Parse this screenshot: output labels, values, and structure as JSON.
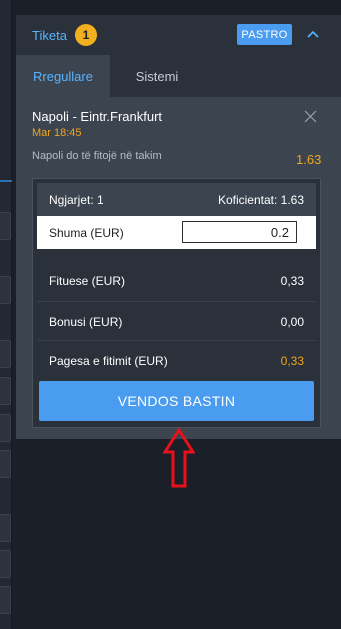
{
  "ticket": {
    "title": "Tiketa",
    "count": "1",
    "clear_label": "PASTRO",
    "collapse_icon": "chevron-up-icon"
  },
  "tabs": [
    {
      "label": "Rregullare",
      "active": true
    },
    {
      "label": "Sistemi",
      "active": false
    }
  ],
  "selection": {
    "match": "Napoli - Eintr.Frankfurt",
    "time": "Mar 18:45",
    "market": "Napoli do të fitojë në takim",
    "odd": "1.63"
  },
  "summary": {
    "events_label": "Ngjarjet: 1",
    "odds_label": "Koficientat: 1.63",
    "stake_label": "Shuma (EUR)",
    "stake_value": "0.2",
    "winnings_label": "Fituese (EUR)",
    "winnings_value": "0,33",
    "bonus_label": "Bonusi (EUR)",
    "bonus_value": "0,00",
    "payout_label": "Pagesa e fitimit (EUR)",
    "payout_value": "0,33"
  },
  "place_bet_label": "VENDOS BASTIN",
  "colors": {
    "accent_blue": "#4a9cf0",
    "link_blue": "#58b4ff",
    "odd_orange": "#f2a41e",
    "badge_yellow": "#f2b01e",
    "arrow_red": "#e8101a"
  }
}
